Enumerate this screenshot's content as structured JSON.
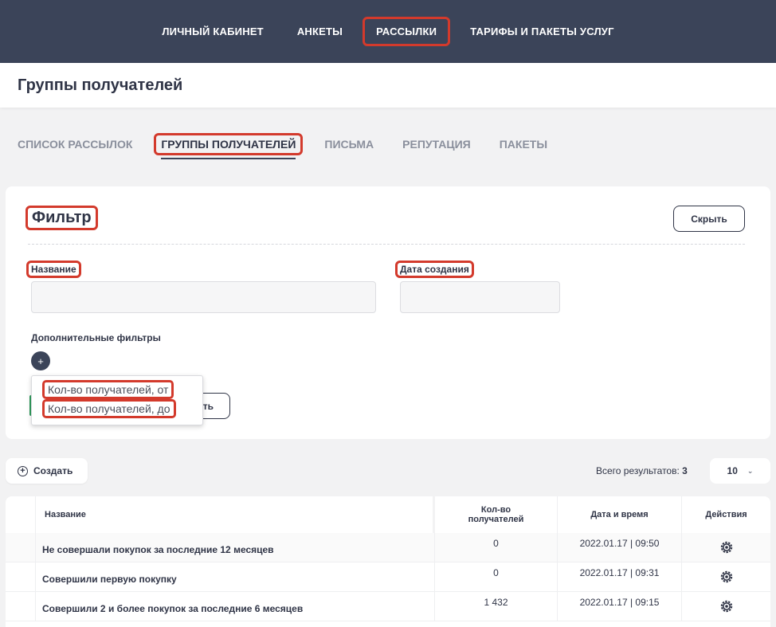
{
  "topnav": {
    "items": [
      {
        "label": "ЛИЧНЫЙ КАБИНЕТ"
      },
      {
        "label": "АНКЕТЫ"
      },
      {
        "label": "РАССЫЛКИ"
      },
      {
        "label": "ТАРИФЫ И ПАКЕТЫ УСЛУГ"
      }
    ],
    "active_index": 2
  },
  "header": {
    "title": "Группы получателей"
  },
  "tabs": [
    {
      "label": "СПИСОК РАССЫЛОК"
    },
    {
      "label": "ГРУППЫ ПОЛУЧАТЕЛЕЙ"
    },
    {
      "label": "ПИСЬМА"
    },
    {
      "label": "РЕПУТАЦИЯ"
    },
    {
      "label": "ПАКЕТЫ"
    }
  ],
  "active_tab_index": 1,
  "filter": {
    "title": "Фильтр",
    "hide_label": "Скрыть",
    "name_label": "Название",
    "name_value": "",
    "date_label": "Дата создания",
    "date_value": "",
    "extra_label": "Дополнительные фильтры",
    "plus_label": "+",
    "ghost_button_label": "ть",
    "dropdown_options": [
      "Кол-во получателей, от",
      "Кол-во получателей, до"
    ]
  },
  "toolbar": {
    "create_label": "Создать",
    "total_label": "Всего результатов:",
    "total_value": "3",
    "per_page": "10"
  },
  "table": {
    "headers": {
      "name": "Название",
      "count": "Кол-во получателей",
      "datetime": "Дата и время",
      "actions": "Действия"
    },
    "rows": [
      {
        "name": "Не совершали покупок за последние 12 месяцев",
        "count": "0",
        "datetime": "2022.01.17 | 09:50"
      },
      {
        "name": "Совершили первую покупку",
        "count": "0",
        "datetime": "2022.01.17 | 09:31"
      },
      {
        "name": "Совершили 2 и более покупок за последние 6 месяцев",
        "count": "1 432",
        "datetime": "2022.01.17 | 09:15"
      }
    ]
  },
  "colors": {
    "nav_bg": "#3b4459",
    "highlight": "#d33a2c",
    "text_dark": "#2f3446",
    "muted_tab": "#8a8f9c"
  }
}
